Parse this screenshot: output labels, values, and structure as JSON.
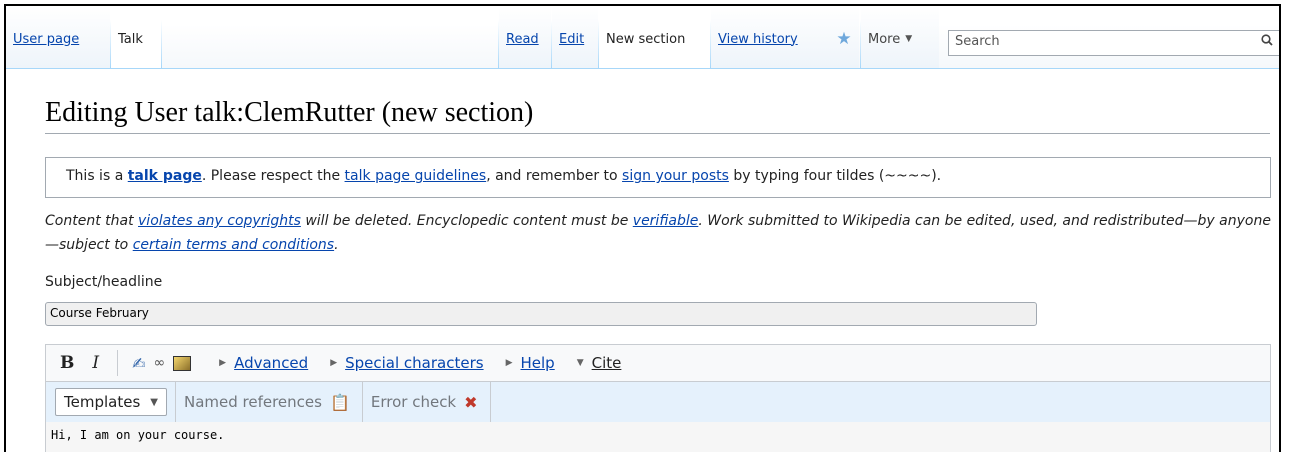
{
  "tabs_left": [
    {
      "label": "User page",
      "link": true
    },
    {
      "label": "Talk",
      "link": false
    }
  ],
  "tabs_right": {
    "read": "Read",
    "edit": "Edit",
    "new_section": "New section",
    "view_history": "View history",
    "more": "More"
  },
  "search": {
    "placeholder": "Search"
  },
  "page_title": "Editing User talk:ClemRutter (new section)",
  "notice": {
    "p1": "This is a ",
    "talk_page": "talk page",
    "p2": ". Please respect the ",
    "guidelines": "talk page guidelines",
    "p3": ", and remember to ",
    "sign": "sign your posts",
    "p4": " by typing four tildes (~~~~)."
  },
  "copyright": {
    "c1": "Content that ",
    "violates": "violates any copyrights",
    "c2": " will be deleted. Encyclopedic content must be ",
    "verifiable": "verifiable",
    "c3": ". Work submitted to Wikipedia can be edited, used, and redistributed—by anyone—subject to ",
    "terms": "certain terms and conditions",
    "c4": "."
  },
  "subject": {
    "label": "Subject/headline",
    "value": "Course February"
  },
  "toolbar": {
    "bold": "B",
    "italic": "I",
    "advanced": "Advanced",
    "special": "Special characters",
    "help": "Help",
    "cite": "Cite",
    "templates": "Templates",
    "named_refs": "Named references",
    "error_check": "Error check"
  },
  "textarea": {
    "value": "Hi, I am on your course."
  }
}
